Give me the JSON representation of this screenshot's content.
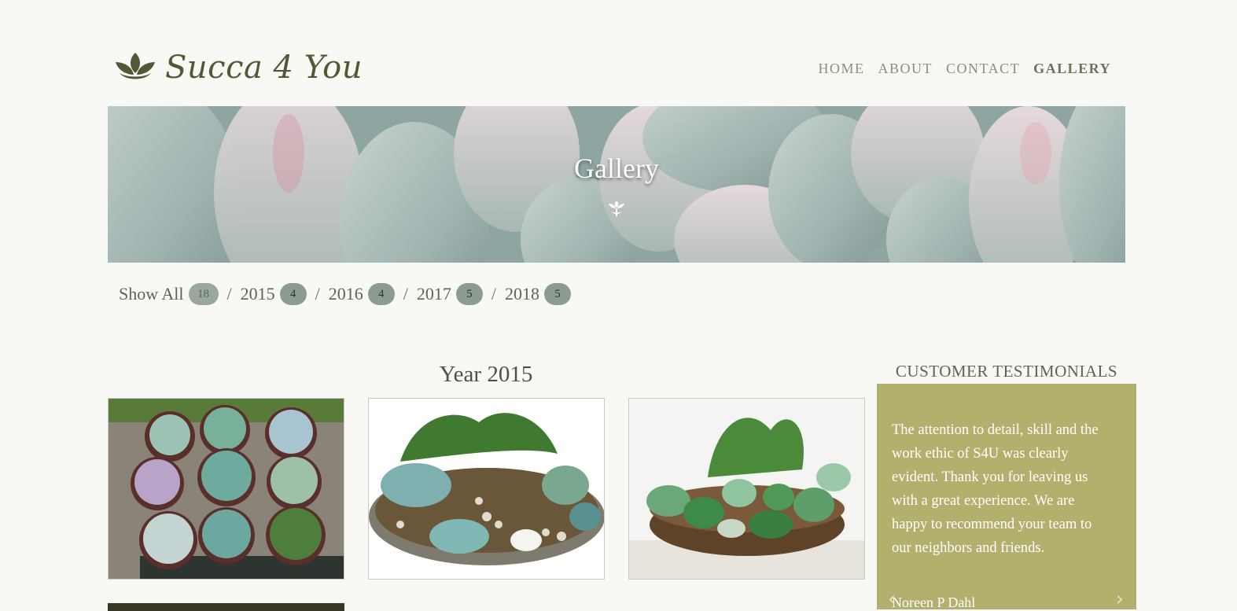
{
  "header": {
    "logo_text": "Succa 4 You",
    "nav": [
      {
        "label": "HOME",
        "active": false
      },
      {
        "label": "ABOUT",
        "active": false
      },
      {
        "label": "CONTACT",
        "active": false
      },
      {
        "label": "GALLERY",
        "active": true
      }
    ]
  },
  "hero": {
    "title": "Gallery",
    "icon": "succulent-icon"
  },
  "filters": [
    {
      "label": "Show All",
      "count": "18"
    },
    {
      "label": "2015",
      "count": "4"
    },
    {
      "label": "2016",
      "count": "4"
    },
    {
      "label": "2017",
      "count": "5"
    },
    {
      "label": "2018",
      "count": "5"
    }
  ],
  "filter_separator": "/",
  "gallery": {
    "heading": "Year 2015"
  },
  "testimonials": {
    "title": "CUSTOMER TESTIMONIALS",
    "quote": "The attention to detail, skill and the work ethic of S4U was clearly evident. Thank you for leaving us with a great experience. We are happy to recommend your team to our neighbors and friends.",
    "author": "Noreen P Dahl",
    "prev_icon": "chevron-left-icon",
    "next_icon": "chevron-right-icon"
  },
  "colors": {
    "accent": "#b3b06d",
    "brand": "#4f5a35",
    "background": "#f8f9f5",
    "badge": "#8c9c90"
  }
}
